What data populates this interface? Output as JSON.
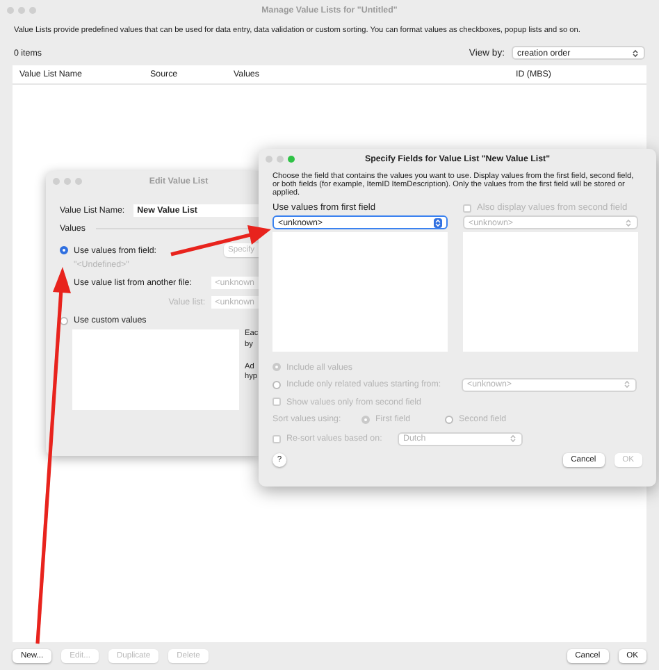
{
  "main_window": {
    "title": "Manage Value Lists for \"Untitled\"",
    "description": "Value Lists provide predefined values that can be used for data entry, data validation or custom sorting. You can format values as checkboxes, popup lists and so on.",
    "item_count": "0 items",
    "view_by": {
      "label": "View by:",
      "value": "creation order"
    },
    "table": {
      "columns": [
        "Value List Name",
        "Source",
        "Values",
        "ID (MBS)"
      ]
    },
    "left_buttons": [
      {
        "label": "New...",
        "disabled": false
      },
      {
        "label": "Edit...",
        "disabled": true
      },
      {
        "label": "Duplicate",
        "disabled": true
      },
      {
        "label": "Delete",
        "disabled": true
      }
    ],
    "right_buttons": [
      {
        "label": "Cancel",
        "disabled": false
      },
      {
        "label": "OK",
        "disabled": false
      }
    ]
  },
  "edit_window": {
    "title": "Edit Value List",
    "name_label": "Value List Name:",
    "name_value": "New Value List",
    "values_heading": "Values",
    "sources": [
      {
        "label": "Use values from field:",
        "selected": true
      },
      {
        "label": "Use value list from another file:",
        "selected": false
      },
      {
        "label": "Use custom values",
        "selected": false
      }
    ],
    "specify_button": "Specify",
    "field_value": "\"<Undefined>\"",
    "file_select": "<unknown",
    "value_list_label": "Value list:",
    "value_list_select": "<unknown",
    "notes": [
      "Eac by",
      "Ad hyp"
    ]
  },
  "specify_dialog": {
    "title": "Specify Fields for Value List \"New Value List\"",
    "description": "Choose the field that contains the values you want to use.  Display values from the first field, second field, or both fields (for example, ItemID ItemDescription). Only the values from the first field will be stored or applied.",
    "first_field": {
      "label": "Use values from first field",
      "value": "<unknown>"
    },
    "second_field": {
      "label": "Also display values from second field",
      "checked": false,
      "disabled": true,
      "value": "<unknown>"
    },
    "include_options": [
      {
        "label": "Include all values",
        "selected": true,
        "disabled": true
      },
      {
        "label": "Include only related values starting from:",
        "selected": false,
        "disabled": true,
        "select": "<unknown>"
      }
    ],
    "show_second_only": {
      "label": "Show values only from second field",
      "checked": false,
      "disabled": true
    },
    "sort": {
      "label": "Sort values using:",
      "disabled": true,
      "options": [
        {
          "label": "First field",
          "selected": true,
          "disabled": true
        },
        {
          "label": "Second field",
          "selected": false,
          "disabled": true
        }
      ]
    },
    "resort": {
      "label": "Re-sort values based on:",
      "checked": false,
      "disabled": true,
      "select": "Dutch"
    },
    "help": "?",
    "buttons": [
      {
        "label": "Cancel",
        "disabled": false
      },
      {
        "label": "OK",
        "disabled": true
      }
    ]
  }
}
